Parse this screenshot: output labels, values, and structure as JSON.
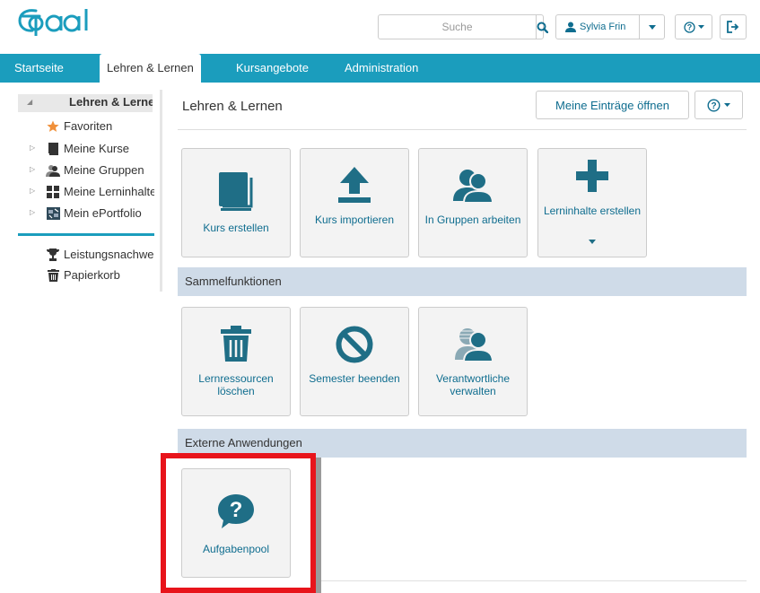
{
  "header": {
    "logo_alt": "Opal",
    "search": {
      "placeholder": "Suche"
    },
    "user": {
      "name": "Sylvia Frin"
    }
  },
  "nav": {
    "tabs": [
      {
        "label": "Startseite"
      },
      {
        "label": "Lehren & Lernen"
      },
      {
        "label": "Kursangebote"
      },
      {
        "label": "Administration"
      }
    ]
  },
  "sidebar": {
    "root": "Lehren & Lernen",
    "items": [
      {
        "label": "Favoriten",
        "icon": "star-icon"
      },
      {
        "label": "Meine Kurse",
        "icon": "book-icon"
      },
      {
        "label": "Meine Gruppen",
        "icon": "group-icon"
      },
      {
        "label": "Meine Lerninhalte",
        "icon": "grid-icon"
      },
      {
        "label": "Mein ePortfolio",
        "icon": "portfolio-icon"
      }
    ],
    "bottom_items": [
      {
        "label": "Leistungsnachweise",
        "icon": "trophy-icon"
      },
      {
        "label": "Papierkorb",
        "icon": "trash-icon"
      }
    ]
  },
  "main": {
    "title": "Lehren & Lernen",
    "open_entries_button": "Meine Einträge öffnen",
    "tiles_top": [
      {
        "label": "Kurs erstellen",
        "icon": "book-icon"
      },
      {
        "label": "Kurs importieren",
        "icon": "upload-icon"
      },
      {
        "label": "In Gruppen arbeiten",
        "icon": "group-icon"
      },
      {
        "label": "Lerninhalte erstellen",
        "icon": "plus-icon"
      }
    ],
    "section_collective": "Sammelfunktionen",
    "tiles_collective": [
      {
        "label": "Lernressourcen löschen",
        "icon": "trash-icon"
      },
      {
        "label": "Semester beenden",
        "icon": "ban-icon"
      },
      {
        "label": "Verantwortliche verwalten",
        "icon": "user-manage-icon"
      }
    ],
    "section_external": "Externe Anwendungen",
    "tiles_external": [
      {
        "label": "Aufgabenpool",
        "icon": "question-bubble-icon"
      }
    ]
  },
  "colors": {
    "brand": "#1b9dbd",
    "tile_icon": "#1f6e86",
    "link": "#0f6d8f",
    "section_bg": "#cfdbe8",
    "highlight": "#e8141b"
  }
}
